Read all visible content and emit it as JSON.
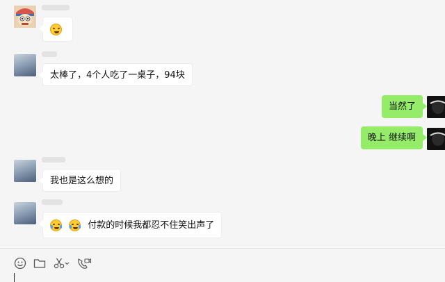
{
  "messages": [
    {
      "side": "left",
      "avatar": "cartoon-avatar",
      "emojis": [
        "squint-grin"
      ],
      "text": ""
    },
    {
      "side": "left",
      "avatar": "photo-avatar",
      "emojis": [],
      "text": "太棒了，4个人吃了一桌子，94块"
    },
    {
      "side": "right",
      "avatar": "dark-avatar",
      "emojis": [],
      "text": "当然了"
    },
    {
      "side": "right",
      "avatar": "dark-avatar",
      "emojis": [],
      "text": "晚上 继续啊"
    },
    {
      "side": "left",
      "avatar": "photo-avatar",
      "emojis": [],
      "text": "我也是这么想的"
    },
    {
      "side": "left",
      "avatar": "photo-avatar",
      "emojis": [
        "laugh-cry",
        "laugh-cry"
      ],
      "text": "付款的时候我都忍不住笑出声了"
    }
  ],
  "toolbar": {
    "icons": [
      "emoji-icon",
      "folder-icon",
      "scissors-icon",
      "video-call-icon"
    ]
  },
  "colors": {
    "background": "#f5f5f5",
    "left_bubble": "#ffffff",
    "right_bubble": "#95ec69"
  }
}
